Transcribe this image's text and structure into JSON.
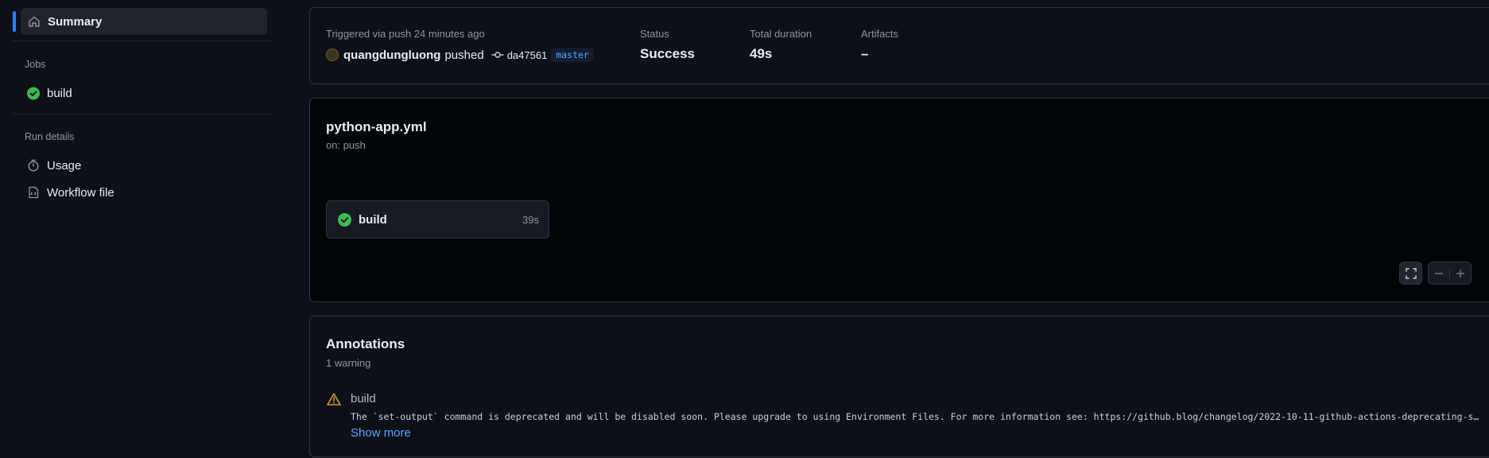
{
  "sidebar": {
    "summary_label": "Summary",
    "jobs_heading": "Jobs",
    "jobs": [
      {
        "label": "build",
        "status": "success"
      }
    ],
    "run_details_heading": "Run details",
    "run_details": [
      {
        "label": "Usage",
        "icon": "stopwatch-icon"
      },
      {
        "label": "Workflow file",
        "icon": "file-code-icon"
      }
    ]
  },
  "run_summary": {
    "trigger_text": "Triggered via push 24 minutes ago",
    "actor": "quangdungluong",
    "action": "pushed",
    "commit_sha": "da47561",
    "branch": "master",
    "status_label": "Status",
    "status_value": "Success",
    "duration_label": "Total duration",
    "duration_value": "49s",
    "artifacts_label": "Artifacts",
    "artifacts_value": "–"
  },
  "workflow": {
    "file_name": "python-app.yml",
    "trigger": "on: push",
    "job": {
      "name": "build",
      "duration": "39s",
      "status": "success"
    }
  },
  "annotations": {
    "title": "Annotations",
    "count_text": "1 warning",
    "items": [
      {
        "job": "build",
        "level": "warning",
        "message": "The `set-output` command is deprecated and will be disabled soon. Please upgrade to using Environment Files. For more information see: https://github.blog/changelog/2022-10-11-github-actions-deprecating-save-state-and-set-output-commands/"
      }
    ],
    "show_more_label": "Show more"
  },
  "colors": {
    "background": "#0d1117",
    "accent": "#2f81f7",
    "success": "#3fb950",
    "warning": "#d29922",
    "link": "#58a6ff"
  }
}
